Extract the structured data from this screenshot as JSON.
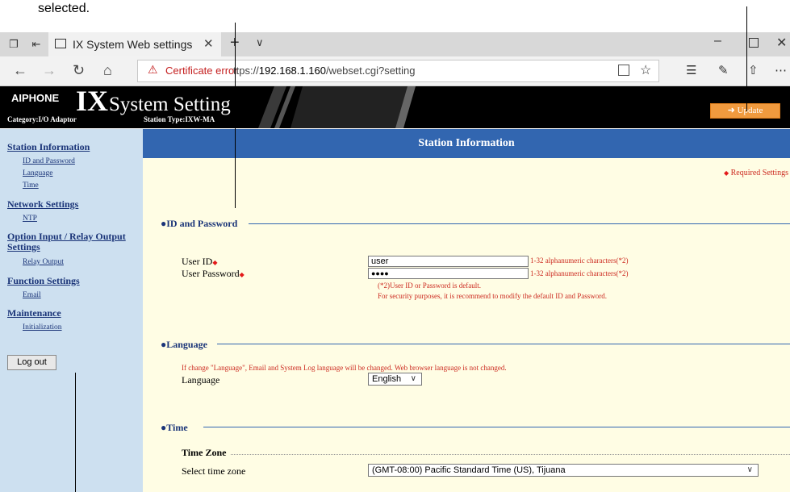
{
  "annotation": {
    "selected_text": "selected."
  },
  "browser": {
    "tab_title": "IX System Web settings",
    "certificate_error": "Certificate error",
    "url_prefix": "ttps://",
    "url_host": "192.168.1.160",
    "url_path": "/webset.cgi?setting"
  },
  "header": {
    "brand": "AIPHONE",
    "ix": "IX",
    "system_setting": "System Setting",
    "category": "Category:I/O Adaptor",
    "station_type": "Station Type:IXW-MA",
    "update_label": "Update"
  },
  "sidebar": {
    "sections": [
      {
        "label": "Station Information",
        "links": [
          "ID and Password",
          "Language",
          "Time"
        ]
      },
      {
        "label": "Network Settings",
        "links": [
          "NTP"
        ]
      },
      {
        "label": "Option Input / Relay Output Settings",
        "links": [
          "Relay Output"
        ]
      },
      {
        "label": "Function Settings",
        "links": [
          "Email"
        ]
      },
      {
        "label": "Maintenance",
        "links": [
          "Initialization"
        ]
      }
    ],
    "logout_label": "Log out"
  },
  "main": {
    "title": "Station Information",
    "required_note": "Required Settings",
    "id_password": {
      "title": "ID and Password",
      "user_id_label": "User ID",
      "user_id_value": "user",
      "user_password_label": "User Password",
      "user_password_value": "●●●●",
      "hint": "1-32 alphanumeric characters(*2)",
      "note1": "(*2)User ID or Password is default.",
      "note2": "For security purposes, it is recommend to modify the default ID and Password."
    },
    "language": {
      "title": "Language",
      "note": "If change \"Language\", Email and System Log language will be changed. Web browser language is not changed.",
      "label": "Language",
      "selected": "English"
    },
    "time": {
      "title": "Time",
      "time_zone": "Time Zone",
      "select_label": "Select time zone",
      "selected": "(GMT-08:00) Pacific Standard Time (US), Tijuana"
    }
  }
}
